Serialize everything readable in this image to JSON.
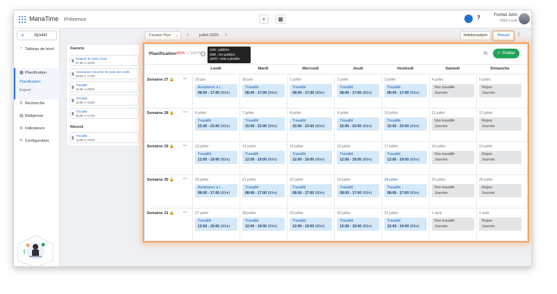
{
  "app": {
    "name": "ManaTime",
    "page": "Présence"
  },
  "topbar": {
    "add_icon": "+",
    "calendar_icon": "▦",
    "help_icon": "?",
    "user_name": "Formet John",
    "user_company": "D&S Luxe"
  },
  "sidebar": {
    "add_label": "Ajouter",
    "items": [
      {
        "label": "Tableau de bord",
        "icon": "dashboard-icon"
      },
      {
        "label": "Planification",
        "icon": "calendar-icon"
      },
      {
        "label": "Recherche",
        "icon": "search-icon"
      },
      {
        "label": "Badgeuse",
        "icon": "badge-icon"
      },
      {
        "label": "Indicateurs",
        "icon": "chart-icon"
      },
      {
        "label": "Configuration",
        "icon": "wrench-icon"
      }
    ],
    "sub_items": [
      "Planification",
      "Export"
    ]
  },
  "favorites": {
    "title": "Favoris",
    "items": [
      {
        "title": "Rapport de visite client",
        "time": "07:30 ➔ 15:00"
      },
      {
        "title": "Assistance à la prise en main des outils",
        "time": "08:00 ➔ 17:00"
      },
      {
        "title": "Travaillé",
        "time": "20:00 ➔ 08:00"
      },
      {
        "title": "Travaillé",
        "time": "15:00 ➔ 23:00"
      },
      {
        "title": "Travaillé",
        "time": "08:00 ➔ 17:00"
      }
    ],
    "recent_title": "Récent",
    "recent": [
      {
        "title": "Travaillé",
        "time": "12:00 ➔ 19:00"
      }
    ]
  },
  "controls": {
    "person": "Faradet Pipo",
    "prev": "‹",
    "next": "›",
    "date": "juillet 2026",
    "weekly": "Hebdomadaire",
    "manual": "Manuel"
  },
  "planning": {
    "title": "Planification",
    "hours": "400h",
    "total": "/ 1607h",
    "tooltip": [
      "115h : publiées",
      "285h : non publiées",
      "1207h : reste à planifier"
    ],
    "publish": "Publier",
    "days": [
      "Lundi",
      "Mardi",
      "Mercredi",
      "Jeudi",
      "Vendredi",
      "Samedi",
      "Dimanche"
    ],
    "weeks": [
      {
        "label": "Semaine 27",
        "cells": [
          {
            "date": "29 juin",
            "type": "work",
            "name": "Assistance à l...",
            "time": "08:00 - 17:00",
            "dur": "(60m)"
          },
          {
            "date": "30 juin",
            "type": "work",
            "name": "Travaillé",
            "time": "08:00 - 17:00",
            "dur": "(60m)"
          },
          {
            "date": "1 juillet",
            "type": "work",
            "name": "Travaillé",
            "time": "08:00 - 17:00",
            "dur": "(60m)"
          },
          {
            "date": "2 juillet",
            "type": "work",
            "name": "Travaillé",
            "time": "08:00 - 17:00",
            "dur": "(60m)"
          },
          {
            "date": "3 juillet",
            "type": "work",
            "name": "Travaillé",
            "time": "08:00 - 17:00",
            "dur": "(60m)"
          },
          {
            "date": "4 juillet",
            "type": "off",
            "name": "Non travaillé",
            "time": "Journée"
          },
          {
            "date": "5 juillet",
            "type": "off",
            "name": "Repos",
            "time": "Journée"
          }
        ]
      },
      {
        "label": "Semaine 28",
        "cells": [
          {
            "date": "6 juillet",
            "type": "work",
            "name": "Travaillé",
            "time": "15:00 - 23:00",
            "dur": "(60m)"
          },
          {
            "date": "7 juillet",
            "type": "work",
            "name": "Travaillé",
            "time": "15:00 - 23:00",
            "dur": "(60m)"
          },
          {
            "date": "8 juillet",
            "type": "work",
            "name": "Travaillé",
            "time": "15:00 - 23:00",
            "dur": "(60m)"
          },
          {
            "date": "9 juillet",
            "type": "work",
            "name": "Travaillé",
            "time": "15:00 - 23:00",
            "dur": "(60m)"
          },
          {
            "date": "10 juillet",
            "type": "work",
            "name": "Travaillé",
            "time": "15:00 - 23:00",
            "dur": "(60m)"
          },
          {
            "date": "11 juillet",
            "type": "off",
            "name": "Non travaillé",
            "time": "Journée"
          },
          {
            "date": "12 juillet",
            "type": "off",
            "name": "Repos",
            "time": "Journée"
          }
        ]
      },
      {
        "label": "Semaine 29",
        "cells": [
          {
            "date": "13 juillet",
            "type": "work",
            "name": "Travaillé",
            "time": "12:00 - 19:00",
            "dur": "(60m)"
          },
          {
            "date": "14 juillet",
            "type": "work",
            "name": "Travaillé",
            "time": "12:00 - 19:00",
            "dur": "(60m)"
          },
          {
            "date": "15 juillet",
            "type": "work",
            "name": "Travaillé",
            "time": "12:00 - 19:00",
            "dur": "(60m)"
          },
          {
            "date": "16 juillet",
            "type": "work",
            "name": "Travaillé",
            "time": "12:00 - 19:00",
            "dur": "(60m)"
          },
          {
            "date": "17 juillet",
            "type": "work",
            "name": "Travaillé",
            "time": "12:00 - 19:00",
            "dur": "(60m)"
          },
          {
            "date": "18 juillet",
            "type": "off",
            "name": "Non travaillé",
            "time": "Journée"
          },
          {
            "date": "19 juillet",
            "type": "off",
            "name": "Repos",
            "time": "Journée"
          }
        ]
      },
      {
        "label": "Semaine 30",
        "cells": [
          {
            "date": "20 juillet",
            "type": "work",
            "name": "Assistance à l...",
            "time": "08:00 - 17:00",
            "dur": "(60m)"
          },
          {
            "date": "21 juillet",
            "type": "work",
            "name": "Travaillé",
            "time": "08:00 - 17:00",
            "dur": "(60m)"
          },
          {
            "date": "22 juillet",
            "type": "work",
            "name": "Travaillé",
            "time": "08:00 - 17:00",
            "dur": "(60m)"
          },
          {
            "date": "23 juillet",
            "type": "work",
            "name": "Travaillé",
            "time": "08:00 - 17:00",
            "dur": "(60m)"
          },
          {
            "date": "24 juillet",
            "type": "work",
            "name": "Travaillé",
            "time": "08:00 - 17:00",
            "dur": "(60m)",
            "today": true
          },
          {
            "date": "25 juillet",
            "type": "off",
            "name": "Non travaillé",
            "time": "Journée"
          },
          {
            "date": "26 juillet",
            "type": "off",
            "name": "Repos",
            "time": "Journée"
          }
        ]
      },
      {
        "label": "Semaine 31",
        "cells": [
          {
            "date": "27 juillet",
            "type": "work",
            "name": "Travaillé",
            "time": "12:00 - 19:00",
            "dur": "(60m)"
          },
          {
            "date": "28 juillet",
            "type": "work",
            "name": "Travaillé",
            "time": "12:00 - 19:00",
            "dur": "(60m)"
          },
          {
            "date": "29 juillet",
            "type": "work",
            "name": "Travaillé",
            "time": "12:00 - 19:00",
            "dur": "(60m)"
          },
          {
            "date": "30 juillet",
            "type": "work",
            "name": "Travaillé",
            "time": "12:00 - 19:00",
            "dur": "(60m)"
          },
          {
            "date": "31 juillet",
            "type": "work",
            "name": "Travaillé",
            "time": "12:00 - 19:00",
            "dur": "(60m)"
          },
          {
            "date": "1 août",
            "type": "off",
            "name": "Non travaillé",
            "time": "Journée"
          },
          {
            "date": "2 août",
            "type": "off",
            "name": "Repos",
            "time": "Journée"
          }
        ]
      }
    ]
  },
  "colors": {
    "accent": "#1e6fd0",
    "publish": "#22a35a",
    "shift_work": "#d6e9f8",
    "shift_off": "#e4e5e7",
    "highlight": "#f4a261",
    "hours_red": "#d0312d"
  }
}
